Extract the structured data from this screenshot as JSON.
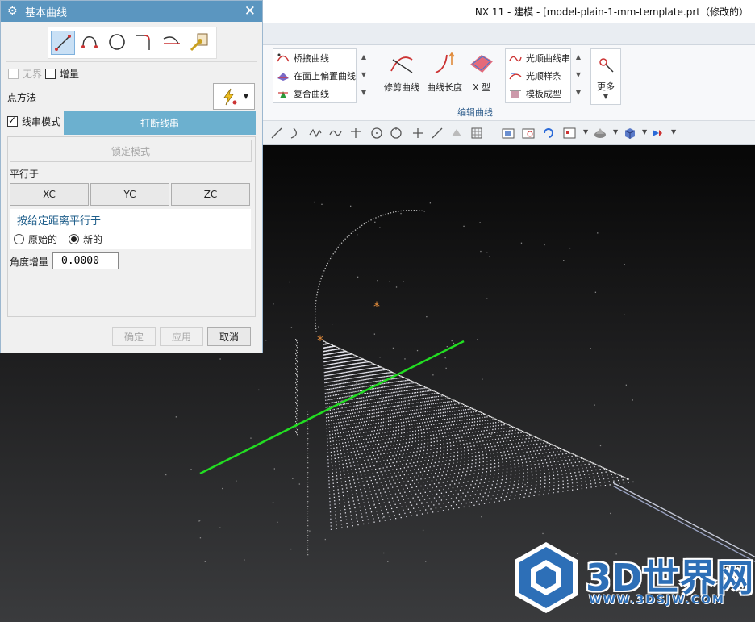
{
  "window": {
    "title": "NX 11 - 建模 - [model-plain-1-mm-template.prt（修改的）"
  },
  "ribbon": {
    "list1": [
      "桥接曲线",
      "在面上偏置曲线",
      "复合曲线"
    ],
    "big_buttons": [
      "修剪曲线",
      "曲线长度",
      "X 型"
    ],
    "list2": [
      "光顺曲线串",
      "光顺样条",
      "模板成型"
    ],
    "more_label": "更多",
    "group_label": "编辑曲线"
  },
  "dialog": {
    "title": "基本曲线",
    "curve_types": [
      "line-icon",
      "arc-icon",
      "circle-icon",
      "fillet-icon",
      "trim-icon",
      "edit-parameters-icon"
    ],
    "infinite_label": "无界",
    "increment_label": "增量",
    "point_method_label": "点方法",
    "string_mode_label": "线串模式",
    "break_string_label": "打断线串",
    "lock_mode_label": "锁定模式",
    "parallel_to_label": "平行于",
    "xc_label": "XC",
    "yc_label": "YC",
    "zc_label": "ZC",
    "dist_parallel_label": "按给定距离平行于",
    "original_label": "原始的",
    "new_label": "新的",
    "angle_increment_label": "角度增量",
    "angle_increment_value": "0.0000",
    "ok_label": "确定",
    "apply_label": "应用",
    "cancel_label": "取消"
  },
  "watermark": {
    "logo_text": "3D世界网",
    "url": "WWW.3DSJW.COM"
  },
  "colors": {
    "dialog_header": "#5b96c0",
    "axis_line": "#22dd22",
    "marker": "#e08a3a",
    "watermark": "#2d6fb7"
  }
}
